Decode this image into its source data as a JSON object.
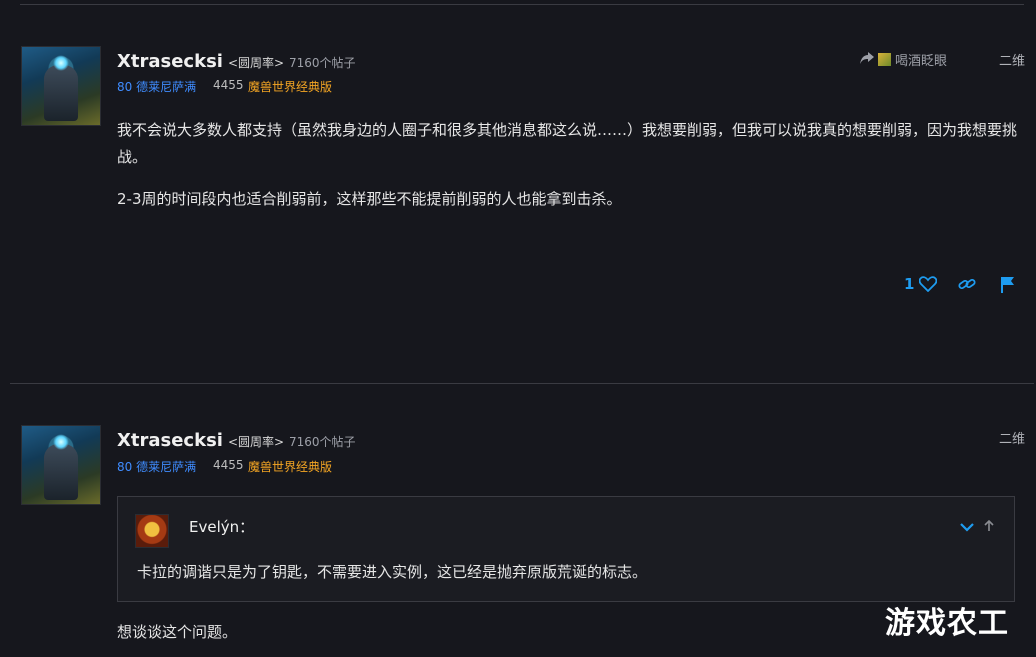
{
  "posts": [
    {
      "author": "Xtrasecksi",
      "title_tag": "<圆周率>",
      "post_count": "7160个帖子",
      "level_class": "80 德莱尼萨满",
      "achievement_points": "4455",
      "game": "魔兽世界经典版",
      "date": "二维",
      "reply_to": "喝酒眨眼",
      "paragraphs": [
        "我不会说大多数人都支持（虽然我身边的人圈子和很多其他消息都这么说……）我想要削弱，但我可以说我真的想要削弱，因为我想要挑战。",
        "2-3周的时间段内也适合削弱前，这样那些不能提前削弱的人也能拿到击杀。"
      ],
      "likes": "1"
    },
    {
      "author": "Xtrasecksi",
      "title_tag": "<圆周率>",
      "post_count": "7160个帖子",
      "level_class": "80 德莱尼萨满",
      "achievement_points": "4455",
      "game": "魔兽世界经典版",
      "date": "二维",
      "quote": {
        "author": "Evelýn：",
        "text": "卡拉的调谐只是为了钥匙，不需要进入实例，这已经是抛弃原版荒诞的标志。"
      },
      "paragraphs": [
        "想谈谈这个问题。"
      ]
    }
  ],
  "icons": {
    "share": "share-arrow-icon",
    "like": "heart-icon",
    "link": "link-icon",
    "flag": "flag-icon",
    "expand": "chevron-down-icon",
    "collapse": "arrow-up-icon"
  },
  "colors": {
    "background": "#16171d",
    "accent_blue": "#1e9cf0",
    "class_blue": "#3f8cff",
    "game_orange": "#f5a623"
  },
  "watermark": "游戏农工"
}
